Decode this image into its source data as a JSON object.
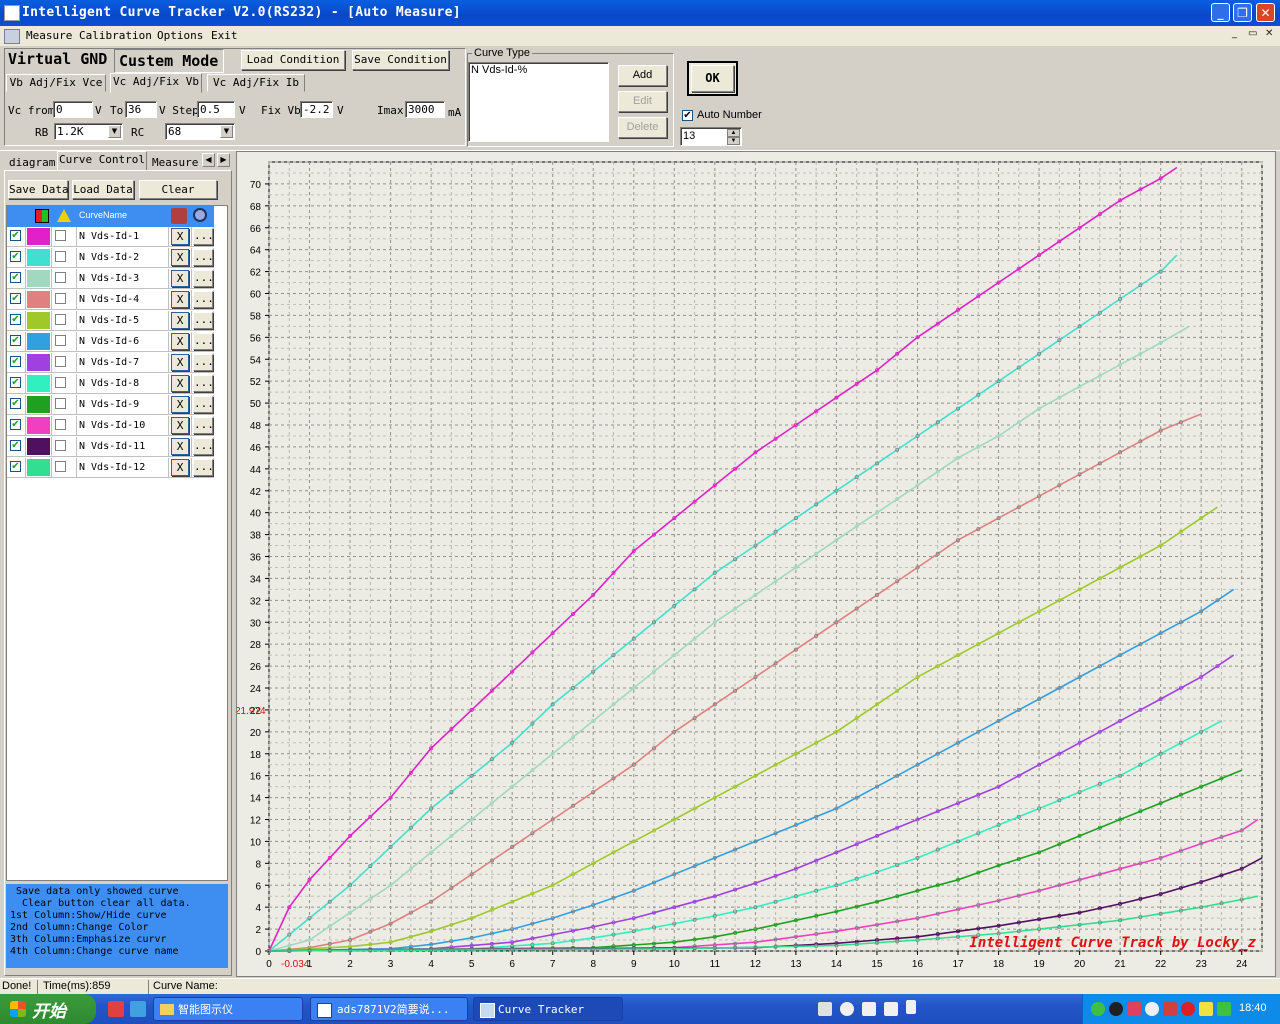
{
  "window": {
    "title": "Intelligent Curve Tracker V2.0(RS232) - [Auto Measure]",
    "controls": [
      "_",
      "❐",
      "✕"
    ],
    "mdi_controls": [
      "_",
      "▭",
      "✕"
    ]
  },
  "menu": [
    "Measure",
    "Calibration",
    "Options",
    "Exit"
  ],
  "toolbar": {
    "virtual_gnd": "Virtual GND",
    "custem_mode": "Custem Mode",
    "load_condition": "Load Condition",
    "save_condition": "Save Condition",
    "mode_tabs": [
      "Vb Adj/Fix Vce",
      "Vc Adj/Fix Vb",
      "Vc Adj/Fix Ib"
    ],
    "vc_from_label": "Vc from",
    "vc_from_value": "0",
    "v_unit": "V",
    "to_label": "To",
    "to_value": "36",
    "v_step_label": "V Step",
    "step_value": "0.5",
    "fix_vb_label": "Fix Vb",
    "fix_vb_value": "-2.2",
    "imax_label": "Imax",
    "imax_value": "3000",
    "ma_unit": "mA",
    "rb_label": "RB",
    "rb_value": "1.2K",
    "rc_label": "RC",
    "rc_value": "68",
    "curve_type_label": "Curve Type",
    "curve_type_text": "N Vds-Id-%",
    "add": "Add",
    "edit": "Edit",
    "delete": "Delete",
    "ok": "OK",
    "auto_number_label": "Auto Number",
    "auto_number_value": "13"
  },
  "left_panel": {
    "tabs": [
      "diagram",
      "Curve Control",
      "Measure"
    ],
    "buttons": [
      "Save Data",
      "Load Data",
      "Clear"
    ],
    "grid_header": "CurveName",
    "curves": [
      {
        "name": "N Vds-Id-1",
        "color": "#e020c8"
      },
      {
        "name": "N Vds-Id-2",
        "color": "#40e0d0"
      },
      {
        "name": "N Vds-Id-3",
        "color": "#a0d8c0"
      },
      {
        "name": "N Vds-Id-4",
        "color": "#e08080"
      },
      {
        "name": "N Vds-Id-5",
        "color": "#a0c828"
      },
      {
        "name": "N Vds-Id-6",
        "color": "#30a0e0"
      },
      {
        "name": "N Vds-Id-7",
        "color": "#a040e0"
      },
      {
        "name": "N Vds-Id-8",
        "color": "#30f0c0"
      },
      {
        "name": "N Vds-Id-9",
        "color": "#20a020"
      },
      {
        "name": "N Vds-Id-10",
        "color": "#f040c0"
      },
      {
        "name": "N Vds-Id-11",
        "color": "#501060"
      },
      {
        "name": "N Vds-Id-12",
        "color": "#30e090"
      }
    ],
    "row_x": "X",
    "row_dots": "...",
    "help_lines": [
      " Save data only showed curve",
      "  Clear button clear all data.",
      "1st Column:Show/Hide curve",
      "2nd Column:Change Color",
      "3th Column:Emphasize curvr",
      "4th Column:Change curve name"
    ]
  },
  "chart_data": {
    "type": "line",
    "watermark": "Intelligent Curve Track by Locky_z",
    "cursor_x_label": "-0.034",
    "cursor_y_label": "21.974",
    "xlim": [
      0,
      24.5
    ],
    "ylim": [
      0,
      72
    ],
    "x_ticks": [
      0,
      1,
      2,
      3,
      4,
      5,
      6,
      7,
      8,
      9,
      10,
      11,
      12,
      13,
      14,
      15,
      16,
      17,
      18,
      19,
      20,
      21,
      22,
      23,
      24
    ],
    "y_ticks": [
      0,
      2,
      4,
      6,
      8,
      10,
      12,
      14,
      16,
      18,
      20,
      22,
      24,
      26,
      28,
      30,
      32,
      34,
      36,
      38,
      40,
      42,
      44,
      46,
      48,
      50,
      52,
      54,
      56,
      58,
      60,
      62,
      64,
      66,
      68,
      70
    ],
    "grid": true,
    "series": [
      {
        "color": "#e020c8",
        "x": [
          0,
          0.5,
          1,
          2,
          3,
          4,
          5,
          6,
          7,
          8,
          9,
          10,
          11,
          12,
          13,
          14,
          15,
          16,
          17,
          18,
          19,
          20,
          21,
          22,
          22.4
        ],
        "y": [
          0,
          4,
          6.5,
          10.5,
          14,
          18.5,
          22,
          25.5,
          29,
          32.5,
          36.5,
          39.5,
          42.5,
          45.5,
          48,
          50.5,
          53,
          56,
          58.5,
          61,
          63.5,
          66,
          68.5,
          70.5,
          71.5
        ]
      },
      {
        "color": "#40e0d0",
        "x": [
          0,
          0.5,
          1,
          2,
          3,
          4,
          5,
          6,
          7,
          8,
          9,
          10,
          11,
          12,
          13,
          14,
          15,
          16,
          17,
          18,
          19,
          20,
          21,
          22,
          22.4
        ],
        "y": [
          0,
          1.5,
          3,
          6,
          9.5,
          13,
          16,
          19,
          22.5,
          25.5,
          28.5,
          31.5,
          34.5,
          37,
          39.5,
          42,
          44.5,
          47,
          49.5,
          52,
          54.5,
          57,
          59.5,
          62,
          63.5
        ]
      },
      {
        "color": "#a0d8c0",
        "x": [
          0,
          1,
          2,
          3,
          4,
          5,
          6,
          7,
          8,
          9,
          10,
          11,
          12,
          13,
          14,
          15,
          16,
          17,
          18,
          19,
          20,
          21,
          22,
          22.7
        ],
        "y": [
          0,
          1,
          3.5,
          6,
          9,
          12,
          15,
          18,
          21,
          24,
          27,
          30,
          32.5,
          35,
          37.5,
          40,
          42.5,
          45,
          47,
          49.5,
          51.5,
          53.5,
          55.5,
          57
        ]
      },
      {
        "color": "#e08080",
        "x": [
          0,
          1,
          2,
          3,
          4,
          5,
          6,
          7,
          8,
          9,
          10,
          11,
          12,
          13,
          14,
          15,
          16,
          17,
          18,
          19,
          20,
          21,
          22,
          23
        ],
        "y": [
          0,
          0.3,
          1,
          2.5,
          4.5,
          7,
          9.5,
          12,
          14.5,
          17,
          20,
          22.5,
          25,
          27.5,
          30,
          32.5,
          35,
          37.5,
          39.5,
          41.5,
          43.5,
          45.5,
          47.5,
          49
        ]
      },
      {
        "color": "#a0c828",
        "x": [
          0,
          2,
          3,
          4,
          5,
          6,
          7,
          8,
          9,
          10,
          11,
          12,
          13,
          14,
          15,
          16,
          17,
          18,
          19,
          20,
          21,
          22,
          23,
          23.4
        ],
        "y": [
          0,
          0.4,
          0.8,
          1.8,
          3,
          4.5,
          6,
          8,
          10,
          12,
          14,
          16,
          18,
          20,
          22.5,
          25,
          27,
          29,
          31,
          33,
          35,
          37,
          39.5,
          40.5
        ]
      },
      {
        "color": "#30a0e0",
        "x": [
          0,
          3,
          4,
          5,
          6,
          7,
          8,
          9,
          10,
          11,
          12,
          13,
          14,
          15,
          16,
          17,
          18,
          19,
          20,
          21,
          22,
          23,
          23.8
        ],
        "y": [
          0,
          0.2,
          0.6,
          1.2,
          2,
          3,
          4.2,
          5.5,
          7,
          8.5,
          10,
          11.5,
          13,
          15,
          17,
          19,
          21,
          23,
          25,
          27,
          29,
          31,
          33
        ]
      },
      {
        "color": "#a040e0",
        "x": [
          0,
          4,
          6,
          7,
          8,
          9,
          10,
          11,
          12,
          13,
          14,
          15,
          16,
          17,
          18,
          19,
          20,
          21,
          22,
          23,
          23.8
        ],
        "y": [
          0,
          0.2,
          0.8,
          1.5,
          2.2,
          3,
          4,
          5,
          6.2,
          7.5,
          9,
          10.5,
          12,
          13.5,
          15,
          17,
          19,
          21,
          23,
          25,
          27
        ]
      },
      {
        "color": "#30f0c0",
        "x": [
          0,
          5,
          7,
          8,
          9,
          10,
          11,
          12,
          13,
          14,
          15,
          16,
          17,
          18,
          19,
          20,
          21,
          22,
          23,
          23.5
        ],
        "y": [
          0,
          0.2,
          0.7,
          1.2,
          1.8,
          2.5,
          3.2,
          4,
          5,
          6,
          7.2,
          8.5,
          10,
          11.5,
          13,
          14.5,
          16,
          18,
          20,
          21
        ]
      },
      {
        "color": "#20a020",
        "x": [
          0,
          8,
          10,
          11,
          12,
          13,
          14,
          15,
          16,
          17,
          18,
          19,
          20,
          21,
          22,
          23,
          24
        ],
        "y": [
          0,
          0.3,
          0.8,
          1.3,
          2,
          2.8,
          3.6,
          4.5,
          5.5,
          6.5,
          7.8,
          9,
          10.5,
          12,
          13.5,
          15,
          16.5
        ]
      },
      {
        "color": "#f040c0",
        "x": [
          0,
          10,
          12,
          13,
          14,
          15,
          16,
          17,
          18,
          19,
          20,
          21,
          22,
          23,
          24,
          24.4
        ],
        "y": [
          0,
          0.3,
          0.8,
          1.3,
          1.8,
          2.4,
          3,
          3.8,
          4.6,
          5.5,
          6.5,
          7.5,
          8.5,
          9.8,
          11,
          12
        ]
      },
      {
        "color": "#501060",
        "x": [
          0,
          12,
          14,
          16,
          17,
          18,
          19,
          20,
          21,
          22,
          23,
          24,
          24.5
        ],
        "y": [
          0,
          0.3,
          0.7,
          1.3,
          1.8,
          2.3,
          2.9,
          3.5,
          4.3,
          5.2,
          6.3,
          7.5,
          8.5
        ]
      },
      {
        "color": "#30e090",
        "x": [
          0,
          10,
          14,
          16,
          18,
          19,
          20,
          21,
          22,
          23,
          24,
          24.4
        ],
        "y": [
          0,
          0.2,
          0.5,
          1,
          1.6,
          2,
          2.4,
          2.8,
          3.4,
          4,
          4.7,
          5
        ]
      }
    ]
  },
  "status": {
    "done": "Done!",
    "time": "Time(ms):859",
    "curve_name": "Curve Name:"
  },
  "taskbar": {
    "start": "开始",
    "tasks": [
      "智能图示仪",
      "ads7871V2简要说...",
      "Curve Tracker"
    ],
    "clock": "18:40"
  }
}
